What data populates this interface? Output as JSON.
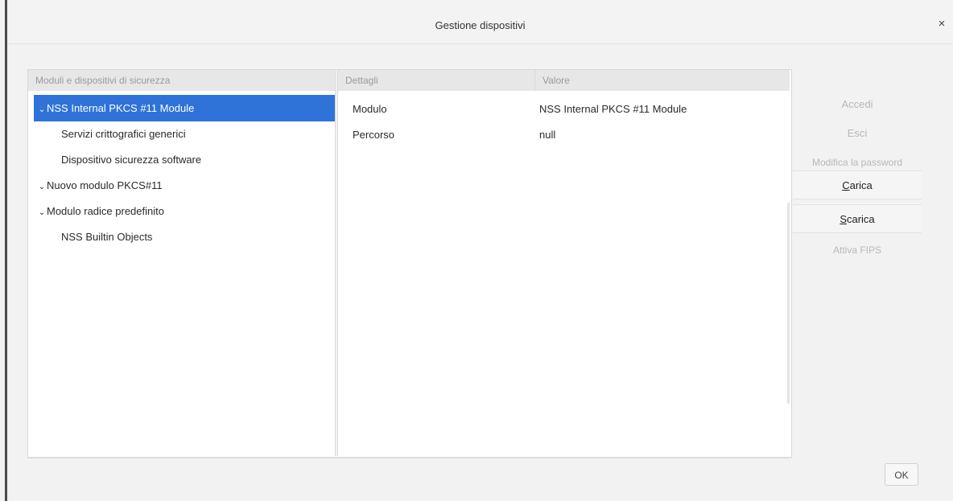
{
  "window": {
    "title": "Gestione dispositivi",
    "close_glyph": "×"
  },
  "tree": {
    "header": "Moduli e dispositivi di sicurezza",
    "rows": [
      {
        "label": "NSS Internal PKCS #11 Module",
        "twisty": "⌄",
        "level": 0,
        "selected": true
      },
      {
        "label": "Servizi crittografici generici",
        "level": 1
      },
      {
        "label": "Dispositivo sicurezza software",
        "level": 1
      },
      {
        "label": "Nuovo modulo PKCS#11",
        "twisty": "⌄",
        "level": 0
      },
      {
        "label": "Modulo radice predefinito",
        "twisty": "⌄",
        "level": 0
      },
      {
        "label": "NSS Builtin Objects",
        "level": 1
      }
    ]
  },
  "details": {
    "header_key": "Dettagli",
    "header_value": "Valore",
    "rows": [
      {
        "key": "Modulo",
        "value": "NSS Internal PKCS #11 Module"
      },
      {
        "key": "Percorso",
        "value": "null"
      }
    ]
  },
  "buttons": {
    "accedi": "Accedi",
    "esci": "Esci",
    "modifica_password": "Modifica la password",
    "carica_first": "C",
    "carica_rest": "arica",
    "scarica_first": "S",
    "scarica_rest": "carica",
    "attiva_fips": "Attiva FIPS",
    "ok": "OK"
  },
  "colors": {
    "selection": "#2f73d8",
    "disabled_text": "#b8b8b8"
  }
}
